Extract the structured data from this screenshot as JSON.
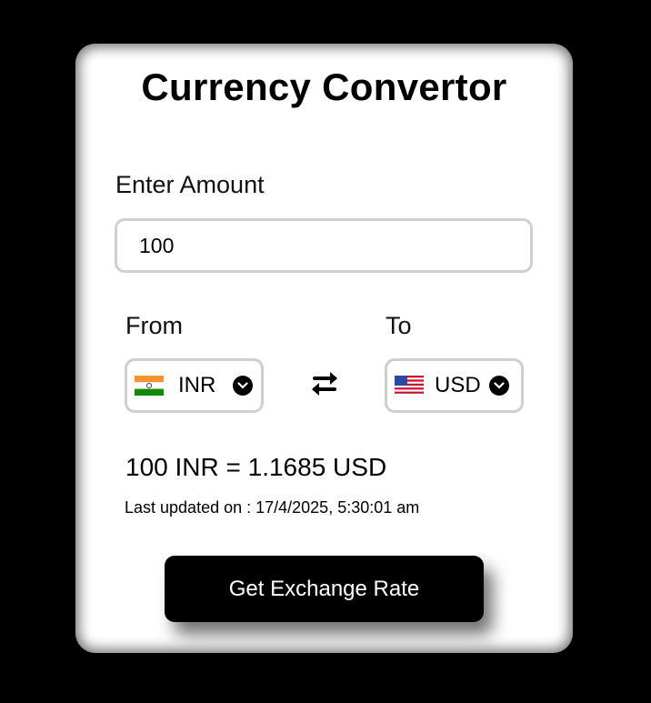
{
  "app": {
    "title": "Currency Convertor"
  },
  "amount": {
    "label": "Enter Amount",
    "value": "100"
  },
  "from": {
    "label": "From",
    "currency": "INR",
    "flag_icon": "india-flag-icon"
  },
  "to": {
    "label": "To",
    "currency": "USD",
    "flag_icon": "usa-flag-icon"
  },
  "swap": {
    "icon": "swap-arrows-icon"
  },
  "result": {
    "text": "100 INR = 1.1685 USD",
    "updated": "Last updated on : 17/4/2025, 5:30:01 am"
  },
  "action": {
    "button_label": "Get Exchange Rate"
  },
  "colors": {
    "background": "#000000",
    "card": "#ffffff",
    "button": "#000000",
    "input_border": "#cfcfcf"
  }
}
